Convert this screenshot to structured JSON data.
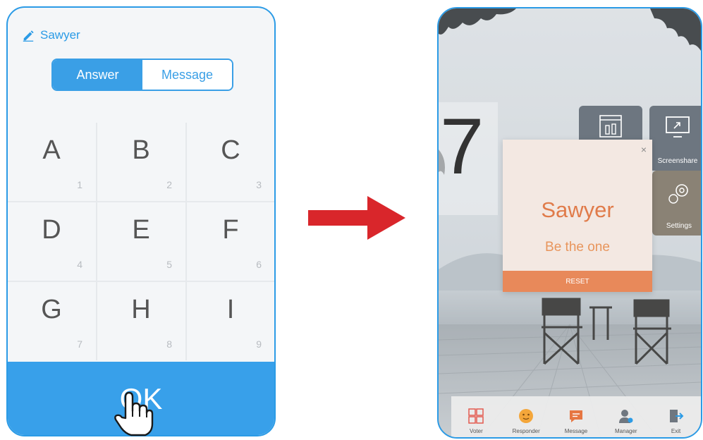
{
  "phone": {
    "user_name": "Sawyer",
    "tabs": [
      {
        "label": "Answer",
        "active": true
      },
      {
        "label": "Message",
        "active": false
      }
    ],
    "keys": [
      {
        "letter": "A",
        "number": "1"
      },
      {
        "letter": "B",
        "number": "2"
      },
      {
        "letter": "C",
        "number": "3"
      },
      {
        "letter": "D",
        "number": "4"
      },
      {
        "letter": "E",
        "number": "5"
      },
      {
        "letter": "F",
        "number": "6"
      },
      {
        "letter": "G",
        "number": "7"
      },
      {
        "letter": "H",
        "number": "8"
      },
      {
        "letter": "I",
        "number": "9"
      }
    ],
    "ok_label": "OK"
  },
  "tablet": {
    "big_number": "7",
    "tiles": {
      "screenshare_label": "Screenshare",
      "settings_label": "Settings"
    },
    "popup": {
      "name": "Sawyer",
      "motto": "Be the one",
      "close": "×",
      "reset_label": "RESET"
    },
    "dock": [
      {
        "label": "Voter",
        "icon": "voter-abcd-icon"
      },
      {
        "label": "Responder",
        "icon": "responder-face-icon"
      },
      {
        "label": "Message",
        "icon": "message-icon"
      },
      {
        "label": "Manager",
        "icon": "manager-icon"
      },
      {
        "label": "Exit",
        "icon": "exit-icon"
      }
    ]
  },
  "colors": {
    "accent_blue": "#38a0ea",
    "arrow_red": "#d9262b",
    "popup_orange": "#e07b4a"
  }
}
